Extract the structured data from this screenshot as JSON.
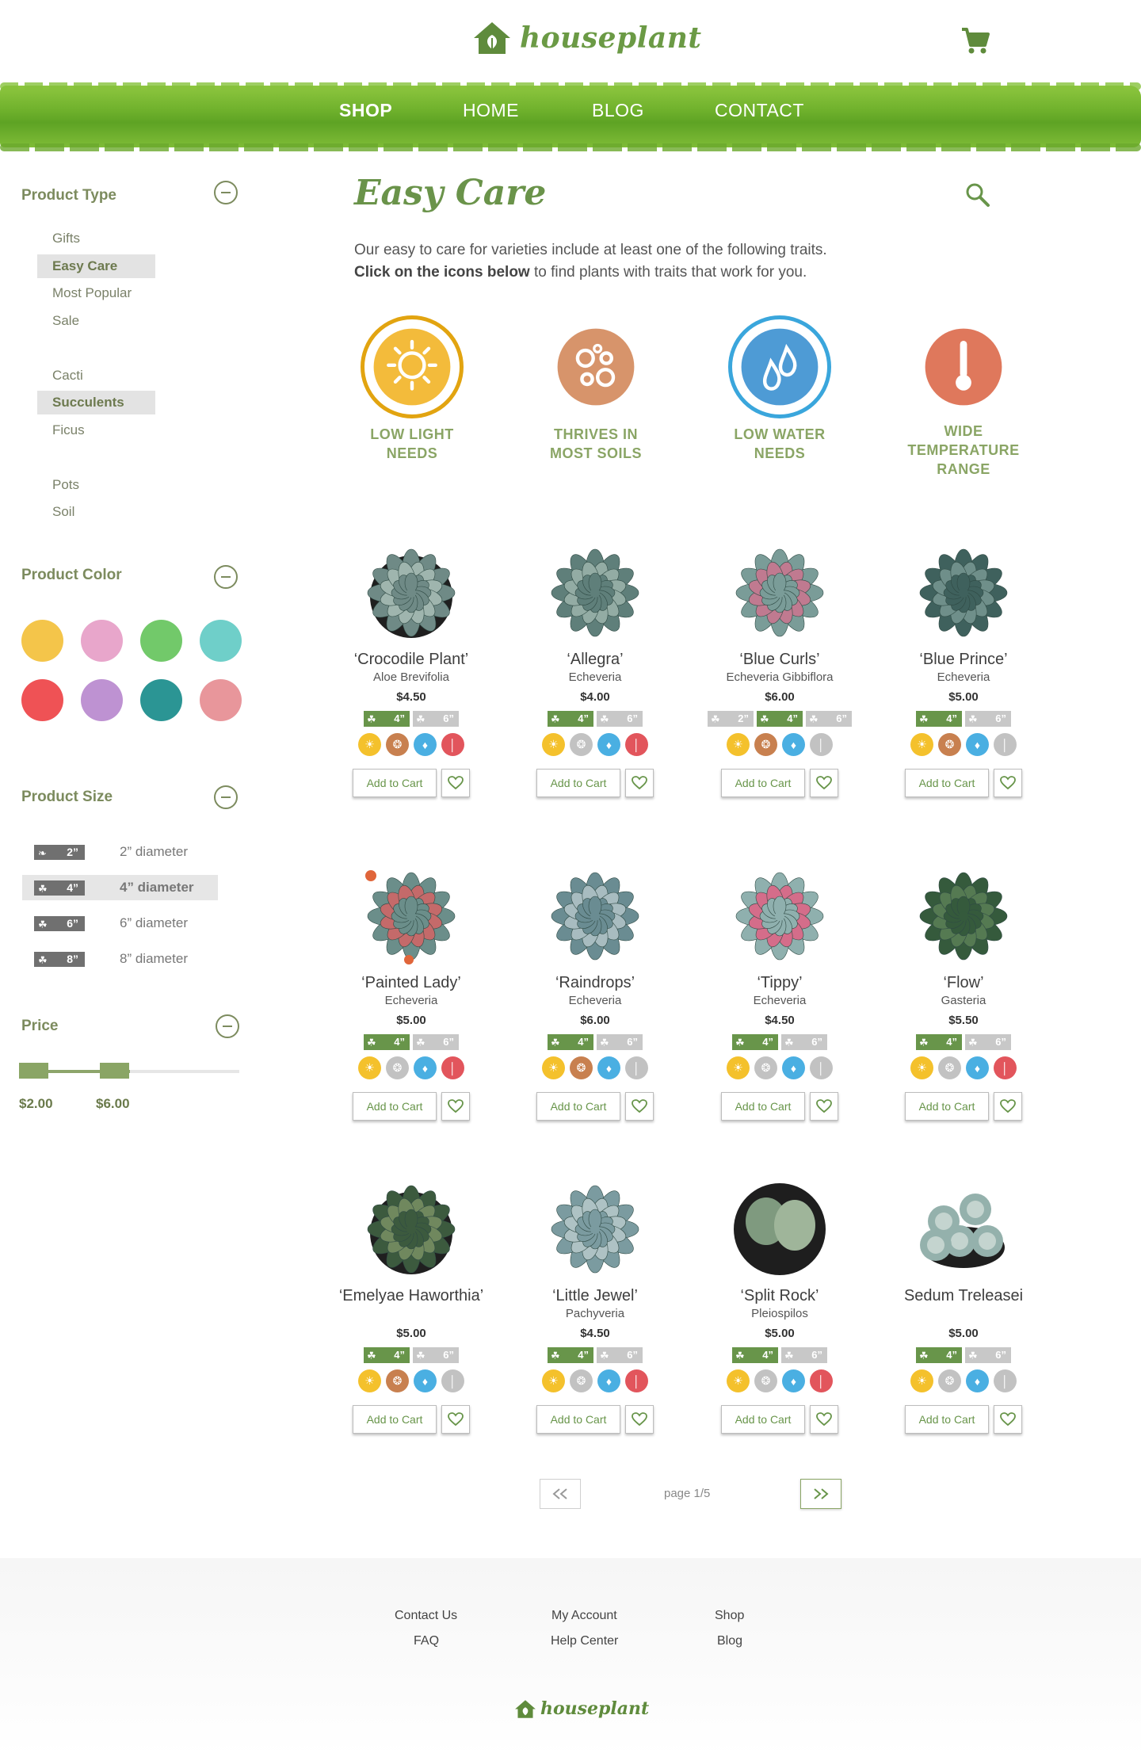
{
  "header": {
    "logo_text": "houseplant",
    "nav": [
      "SHOP",
      "HOME",
      "BLOG",
      "CONTACT"
    ],
    "active_nav": "SHOP"
  },
  "sidebar": {
    "product_type": {
      "title": "Product Type",
      "items": [
        "Gifts",
        "Easy Care",
        "Most Popular",
        "Sale",
        "Cacti",
        "Succulents",
        "Ficus",
        "Pots",
        "Soil"
      ],
      "selected": [
        "Easy Care",
        "Succulents"
      ]
    },
    "product_color": {
      "title": "Product Color",
      "colors": [
        "#f4c54a",
        "#e8a6cb",
        "#72c96a",
        "#6fcfc9",
        "#ef5255",
        "#be92d2",
        "#2b9594",
        "#e8969b"
      ]
    },
    "product_size": {
      "title": "Product Size",
      "sizes": [
        {
          "badge": "2”",
          "label": "2” diameter"
        },
        {
          "badge": "4”",
          "label": "4” diameter"
        },
        {
          "badge": "6”",
          "label": "6” diameter"
        },
        {
          "badge": "8”",
          "label": "8” diameter"
        }
      ],
      "selected": "4” diameter"
    },
    "price": {
      "title": "Price",
      "min_label": "$2.00",
      "max_label": "$6.00"
    }
  },
  "main": {
    "title": "Easy Care",
    "intro_line1": "Our easy to care for varieties include at least one of the following traits.",
    "intro_bold": "Click on the icons below",
    "intro_rest": " to find plants with traits that work for you.",
    "traits": [
      {
        "label": "LOW LIGHT\nNEEDS",
        "icon": "sun-icon",
        "color": "#f2b52a",
        "selected": true
      },
      {
        "label": "THRIVES IN\nMOST SOILS",
        "icon": "soil-icon",
        "color": "#d48b5e",
        "selected": false
      },
      {
        "label": "LOW WATER\nNEEDS",
        "icon": "water-drop-icon",
        "color": "#3f93d1",
        "selected": true
      },
      {
        "label": "WIDE\nTEMPERATURE\nRANGE",
        "icon": "thermometer-icon",
        "color": "#dc6d4e",
        "selected": false
      }
    ],
    "products": [
      {
        "name": "‘Crocodile Plant’",
        "sub": "Aloe Brevifolia",
        "price": "$4.50",
        "sizes": [
          "4”",
          "6”"
        ],
        "avail": [
          true,
          false
        ],
        "traits": [
          true,
          true,
          true,
          true
        ]
      },
      {
        "name": "‘Allegra’",
        "sub": "Echeveria",
        "price": "$4.00",
        "sizes": [
          "4”",
          "6”"
        ],
        "avail": [
          true,
          false
        ],
        "traits": [
          true,
          false,
          true,
          true
        ]
      },
      {
        "name": "‘Blue Curls’",
        "sub": "Echeveria Gibbiflora",
        "price": "$6.00",
        "sizes": [
          "2”",
          "4”",
          "6”"
        ],
        "avail": [
          false,
          true,
          false
        ],
        "traits": [
          true,
          true,
          true,
          false
        ]
      },
      {
        "name": "‘Blue Prince’",
        "sub": "Echeveria",
        "price": "$5.00",
        "sizes": [
          "4”",
          "6”"
        ],
        "avail": [
          true,
          false
        ],
        "traits": [
          true,
          true,
          true,
          false
        ]
      },
      {
        "name": "‘Painted Lady’",
        "sub": "Echeveria",
        "price": "$5.00",
        "sizes": [
          "4”",
          "6”"
        ],
        "avail": [
          true,
          false
        ],
        "traits": [
          true,
          false,
          true,
          true
        ]
      },
      {
        "name": "‘Raindrops’",
        "sub": "Echeveria",
        "price": "$6.00",
        "sizes": [
          "4”",
          "6”"
        ],
        "avail": [
          true,
          false
        ],
        "traits": [
          true,
          true,
          true,
          false
        ]
      },
      {
        "name": "‘Tippy’",
        "sub": "Echeveria",
        "price": "$4.50",
        "sizes": [
          "4”",
          "6”"
        ],
        "avail": [
          true,
          false
        ],
        "traits": [
          true,
          false,
          true,
          false
        ]
      },
      {
        "name": "‘Flow’",
        "sub": "Gasteria",
        "price": "$5.50",
        "sizes": [
          "4”",
          "6”"
        ],
        "avail": [
          true,
          false
        ],
        "traits": [
          true,
          false,
          true,
          true
        ]
      },
      {
        "name": "‘Emelyae Haworthia’",
        "sub": "",
        "price": "$5.00",
        "sizes": [
          "4”",
          "6”"
        ],
        "avail": [
          true,
          false
        ],
        "traits": [
          true,
          true,
          true,
          false
        ]
      },
      {
        "name": "‘Little Jewel’",
        "sub": "Pachyveria",
        "price": "$4.50",
        "sizes": [
          "4”",
          "6”"
        ],
        "avail": [
          true,
          false
        ],
        "traits": [
          true,
          false,
          true,
          true
        ]
      },
      {
        "name": "‘Split Rock’",
        "sub": "Pleiospilos",
        "price": "$5.00",
        "sizes": [
          "4”",
          "6”"
        ],
        "avail": [
          true,
          false
        ],
        "traits": [
          true,
          false,
          true,
          true
        ]
      },
      {
        "name": "Sedum Treleasei",
        "sub": "",
        "price": "$5.00",
        "sizes": [
          "4”",
          "6”"
        ],
        "avail": [
          true,
          false
        ],
        "traits": [
          true,
          false,
          true,
          false
        ]
      }
    ],
    "add_to_cart_label": "Add to Cart",
    "pagination": {
      "label": "page 1/5",
      "prev": "«",
      "next": "»"
    }
  },
  "trait_colors": {
    "sun": "#f4c12c",
    "soil": "#c8804f",
    "water": "#4aafe2",
    "temp": "#e2555c",
    "off": "#c2c2c2"
  },
  "footer": {
    "col1": [
      "Contact Us",
      "FAQ"
    ],
    "col2": [
      "My Account",
      "Help Center"
    ],
    "col3": [
      "Shop",
      "Blog"
    ],
    "logo_text": "houseplant"
  }
}
